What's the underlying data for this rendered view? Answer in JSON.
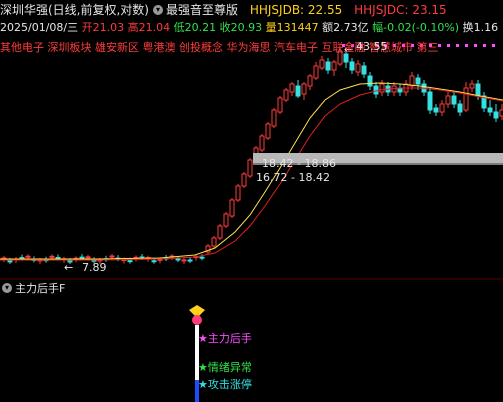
{
  "header": {
    "title": "深圳华强(日线,前复权,对数)",
    "formula_name": "最强音至尊版",
    "indicators": [
      {
        "label": "HHJSJDB: 22.55",
        "color": "#ffd11a"
      },
      {
        "label": "HHJSJDC: 23.15",
        "color": "#ff3b3b"
      }
    ]
  },
  "quote": {
    "date": "2025/01/08/三",
    "open": "开21.03",
    "high": "高21.04",
    "low": "低20.21",
    "close": "收20.93",
    "volume": "量131447",
    "amount": "额2.73亿",
    "change": "幅-0.02(-0.10%)",
    "turnover": "换1.16"
  },
  "concept_tags": [
    "其他电子",
    "深圳板块",
    "雄安新区",
    "粤港澳",
    "创投概念",
    "华为海思",
    "汽车电子",
    "互联金融",
    "智慧城市",
    "第三"
  ],
  "price_labels": {
    "high_marker": "43.55",
    "low_marker": "7.89",
    "band1": "18.42 - 18.86",
    "band2": "16.72 - 18.42"
  },
  "sub_panel": {
    "title": "主力后手F",
    "signals": [
      {
        "label": "★主力后手",
        "color": "#ff4dff"
      },
      {
        "label": "★情绪异常",
        "color": "#33e04a"
      },
      {
        "label": "★攻击涨停",
        "color": "#35e0e0"
      }
    ]
  },
  "colors": {
    "up": "#ff3b3b",
    "down": "#35e0e0",
    "ma_short": "#ffe14d",
    "ma_long": "#e02020",
    "background": "#000000"
  }
}
